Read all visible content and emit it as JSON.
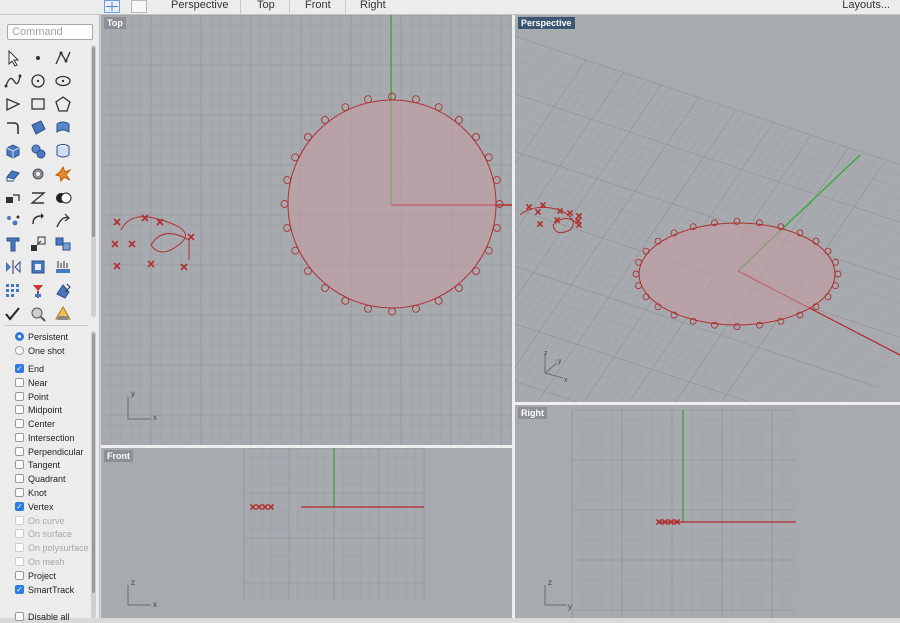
{
  "toolbar": {
    "tabs": [
      {
        "label": "Perspective",
        "active": true
      },
      {
        "label": "Top",
        "active": false
      },
      {
        "label": "Front",
        "active": false
      },
      {
        "label": "Right",
        "active": false
      }
    ],
    "layouts_label": "Layouts..."
  },
  "command": {
    "placeholder": "Command",
    "value": ""
  },
  "tools": [
    "select-arrow-icon",
    "point-icon",
    "polyline-icon",
    "curve-through-points-icon",
    "circle-icon",
    "ellipse-icon",
    "polygon-icon",
    "rectangle-icon",
    "pentagon-icon",
    "fillet-curve-icon",
    "surface-from-curves-icon",
    "loft-surface-icon",
    "box-solid-icon",
    "sphere-group-icon",
    "cylinder-icon",
    "extrude-surface-icon",
    "gear-solid-icon",
    "explode-icon",
    "move-icon",
    "split-icon",
    "boolean-icon",
    "point-cloud-icon",
    "rotate-icon",
    "sweep-icon",
    "text-object-icon",
    "scale-icon",
    "group-icon",
    "mirror-icon",
    "block-icon",
    "array-icon",
    "grid-points-icon",
    "layer-icon",
    "edit-points-icon",
    "check-icon",
    "zoom-icon",
    "render-icon"
  ],
  "osnap": {
    "modes": [
      {
        "label": "Persistent",
        "selected": true
      },
      {
        "label": "One shot",
        "selected": false
      }
    ],
    "items": [
      {
        "label": "End",
        "checked": true,
        "enabled": true
      },
      {
        "label": "Near",
        "checked": false,
        "enabled": true
      },
      {
        "label": "Point",
        "checked": false,
        "enabled": true
      },
      {
        "label": "Midpoint",
        "checked": false,
        "enabled": true
      },
      {
        "label": "Center",
        "checked": false,
        "enabled": true
      },
      {
        "label": "Intersection",
        "checked": false,
        "enabled": true
      },
      {
        "label": "Perpendicular",
        "checked": false,
        "enabled": true
      },
      {
        "label": "Tangent",
        "checked": false,
        "enabled": true
      },
      {
        "label": "Quadrant",
        "checked": false,
        "enabled": true
      },
      {
        "label": "Knot",
        "checked": false,
        "enabled": true
      },
      {
        "label": "Vertex",
        "checked": true,
        "enabled": true
      },
      {
        "label": "On curve",
        "checked": false,
        "enabled": false
      },
      {
        "label": "On surface",
        "checked": false,
        "enabled": false
      },
      {
        "label": "On polysurface",
        "checked": false,
        "enabled": false
      },
      {
        "label": "On mesh",
        "checked": false,
        "enabled": false
      },
      {
        "label": "Project",
        "checked": false,
        "enabled": true
      },
      {
        "label": "SmartTrack",
        "checked": true,
        "enabled": true
      },
      {
        "label": "Disable all",
        "checked": false,
        "enabled": true
      }
    ]
  },
  "viewports": {
    "top": {
      "title": "Top",
      "active": false,
      "axis_labels": [
        "y",
        "x"
      ]
    },
    "perspective": {
      "title": "Perspective",
      "active": true,
      "axis_labels": [
        "z",
        "y",
        "x"
      ]
    },
    "front": {
      "title": "Front",
      "active": false,
      "axis_labels": [
        "z",
        "x"
      ]
    },
    "right": {
      "title": "Right",
      "active": false,
      "axis_labels": [
        "z",
        "y"
      ]
    }
  },
  "colors": {
    "viewport_bg": "#a7abb0",
    "grid_minor": "#9da1a6",
    "grid_major": "#8b8f94",
    "x_axis": "#b42a2a",
    "y_axis": "#3aa53a",
    "curve": "#b0302f",
    "surface_fill": "#c89aa0",
    "active_title_bg": "#3b5775",
    "accent": "#2a6fd6"
  }
}
